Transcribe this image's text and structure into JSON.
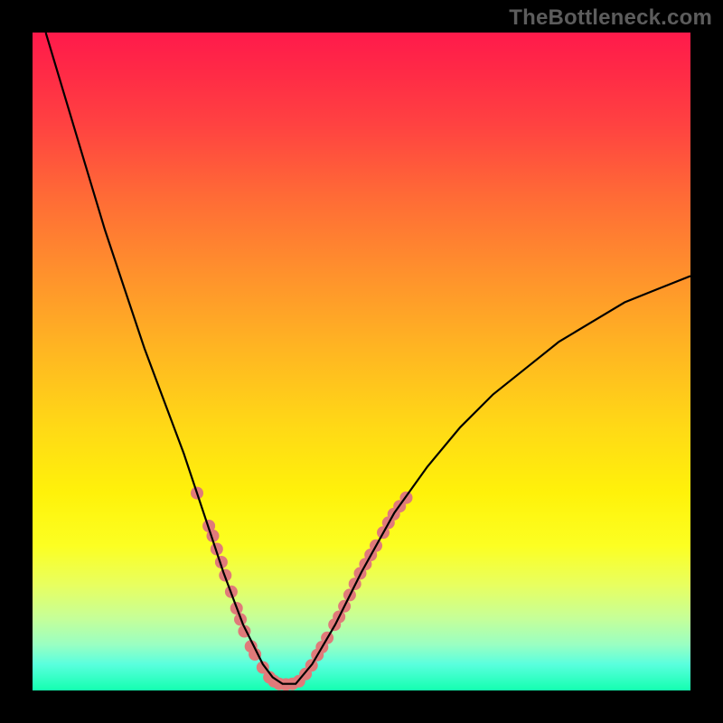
{
  "watermark": "TheBottleneck.com",
  "colors": {
    "frame": "#000000",
    "curve": "#000000",
    "markers": "#e07a7a",
    "gradient_top": "#ff1a4b",
    "gradient_bottom": "#14ffb0"
  },
  "chart_data": {
    "type": "line",
    "title": "",
    "xlabel": "",
    "ylabel": "",
    "xlim": [
      0,
      100
    ],
    "ylim": [
      0,
      100
    ],
    "grid": false,
    "legend": false,
    "series": [
      {
        "name": "bottleneck-curve",
        "x": [
          2,
          5,
          8,
          11,
          14,
          17,
          20,
          23,
          25,
          27,
          29,
          30.5,
          32,
          33.5,
          35,
          36.5,
          38,
          40,
          42.5,
          46,
          50,
          55,
          60,
          65,
          70,
          75,
          80,
          85,
          90,
          95,
          100
        ],
        "y": [
          100,
          90,
          80,
          70,
          61,
          52,
          44,
          36,
          30,
          24,
          18,
          14,
          10,
          7,
          4,
          2,
          1,
          1,
          4,
          10,
          18,
          27,
          34,
          40,
          45,
          49,
          53,
          56,
          59,
          61,
          63
        ]
      }
    ],
    "markers": {
      "name": "highlight-dots",
      "color": "#e07a7a",
      "points": [
        {
          "x": 25.0,
          "y": 30.0
        },
        {
          "x": 26.8,
          "y": 25.0
        },
        {
          "x": 27.4,
          "y": 23.5
        },
        {
          "x": 28.0,
          "y": 21.5
        },
        {
          "x": 28.7,
          "y": 19.5
        },
        {
          "x": 29.3,
          "y": 17.5
        },
        {
          "x": 30.2,
          "y": 15.0
        },
        {
          "x": 31.0,
          "y": 12.5
        },
        {
          "x": 31.6,
          "y": 10.8
        },
        {
          "x": 32.2,
          "y": 9.0
        },
        {
          "x": 33.2,
          "y": 6.7
        },
        {
          "x": 33.8,
          "y": 5.5
        },
        {
          "x": 35.0,
          "y": 3.5
        },
        {
          "x": 36.0,
          "y": 2.0
        },
        {
          "x": 36.7,
          "y": 1.4
        },
        {
          "x": 37.5,
          "y": 1.0
        },
        {
          "x": 38.5,
          "y": 0.9
        },
        {
          "x": 39.5,
          "y": 1.0
        },
        {
          "x": 40.5,
          "y": 1.4
        },
        {
          "x": 41.5,
          "y": 2.5
        },
        {
          "x": 42.4,
          "y": 3.8
        },
        {
          "x": 43.3,
          "y": 5.4
        },
        {
          "x": 44.0,
          "y": 6.6
        },
        {
          "x": 44.8,
          "y": 8.0
        },
        {
          "x": 45.9,
          "y": 10.0
        },
        {
          "x": 46.6,
          "y": 11.2
        },
        {
          "x": 47.4,
          "y": 12.8
        },
        {
          "x": 48.2,
          "y": 14.5
        },
        {
          "x": 49.0,
          "y": 16.2
        },
        {
          "x": 49.8,
          "y": 17.8
        },
        {
          "x": 50.6,
          "y": 19.2
        },
        {
          "x": 51.4,
          "y": 20.6
        },
        {
          "x": 52.2,
          "y": 22.0
        },
        {
          "x": 53.3,
          "y": 24.0
        },
        {
          "x": 54.1,
          "y": 25.5
        },
        {
          "x": 54.9,
          "y": 26.8
        },
        {
          "x": 55.8,
          "y": 28.0
        },
        {
          "x": 56.8,
          "y": 29.3
        }
      ]
    }
  }
}
